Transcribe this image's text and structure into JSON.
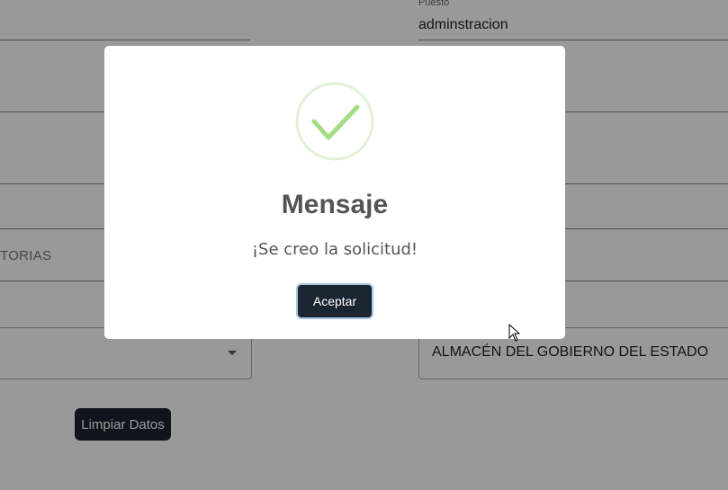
{
  "form": {
    "puesto_label": "Puesto",
    "puesto_value": "adminstracion",
    "convocatorias_fragment": "TORIAS",
    "almacen_value": "ALMACÉN DEL GOBIERNO DEL ESTADO",
    "clear_button": "Limpiar Datos"
  },
  "dialog": {
    "title": "Mensaje",
    "message": "¡Se creo la solicitud!",
    "accept_button": "Aceptar",
    "icon": "success-check-icon",
    "icon_color": "#a5dc86"
  },
  "colors": {
    "button_bg": "#1b2431",
    "overlay": "rgba(0,0,0,0.4)"
  }
}
